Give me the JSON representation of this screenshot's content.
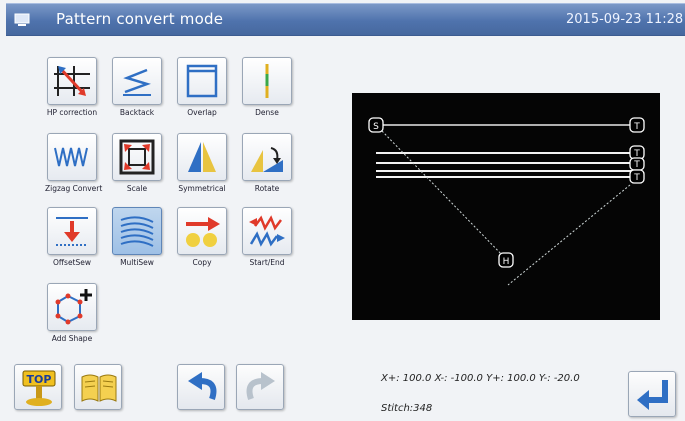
{
  "header": {
    "title": "Pattern convert mode",
    "datetime": "2015-09-23 11:28",
    "icon": "screen-icon"
  },
  "tools": [
    {
      "label": "HP correction",
      "icon": "hp-correction-icon"
    },
    {
      "label": "Backtack",
      "icon": "backtack-icon"
    },
    {
      "label": "Overlap",
      "icon": "overlap-icon"
    },
    {
      "label": "Dense",
      "icon": "dense-icon"
    },
    {
      "label": "Zigzag Convert",
      "icon": "zigzag-icon"
    },
    {
      "label": "Scale",
      "icon": "scale-icon"
    },
    {
      "label": "Symmetrical",
      "icon": "symmetrical-icon"
    },
    {
      "label": "Rotate",
      "icon": "rotate-icon"
    },
    {
      "label": "OffsetSew",
      "icon": "offset-sew-icon"
    },
    {
      "label": "MultiSew",
      "icon": "multi-sew-icon",
      "selected": true
    },
    {
      "label": "Copy",
      "icon": "copy-icon"
    },
    {
      "label": "Start/End",
      "icon": "start-end-icon"
    },
    {
      "label": "Add Shape",
      "icon": "add-shape-icon"
    }
  ],
  "bottom_buttons": [
    {
      "icon": "top-icon",
      "text": "TOP"
    },
    {
      "icon": "book-icon"
    },
    {
      "icon": "undo-icon"
    },
    {
      "icon": "redo-icon"
    },
    {
      "icon": "enter-icon"
    }
  ],
  "preview": {
    "markers": [
      "S",
      "T",
      "T",
      "T",
      "T",
      "H"
    ]
  },
  "readout": {
    "limits": "X+: 100.0  X-: -100.0  Y+: 100.0  Y-: -20.0",
    "stitch": "Stitch:348"
  },
  "colors": {
    "title_bar": "#4f73ad",
    "canvas": "#050505",
    "accent_red": "#e03a2a",
    "accent_blue": "#2f6fc4"
  }
}
